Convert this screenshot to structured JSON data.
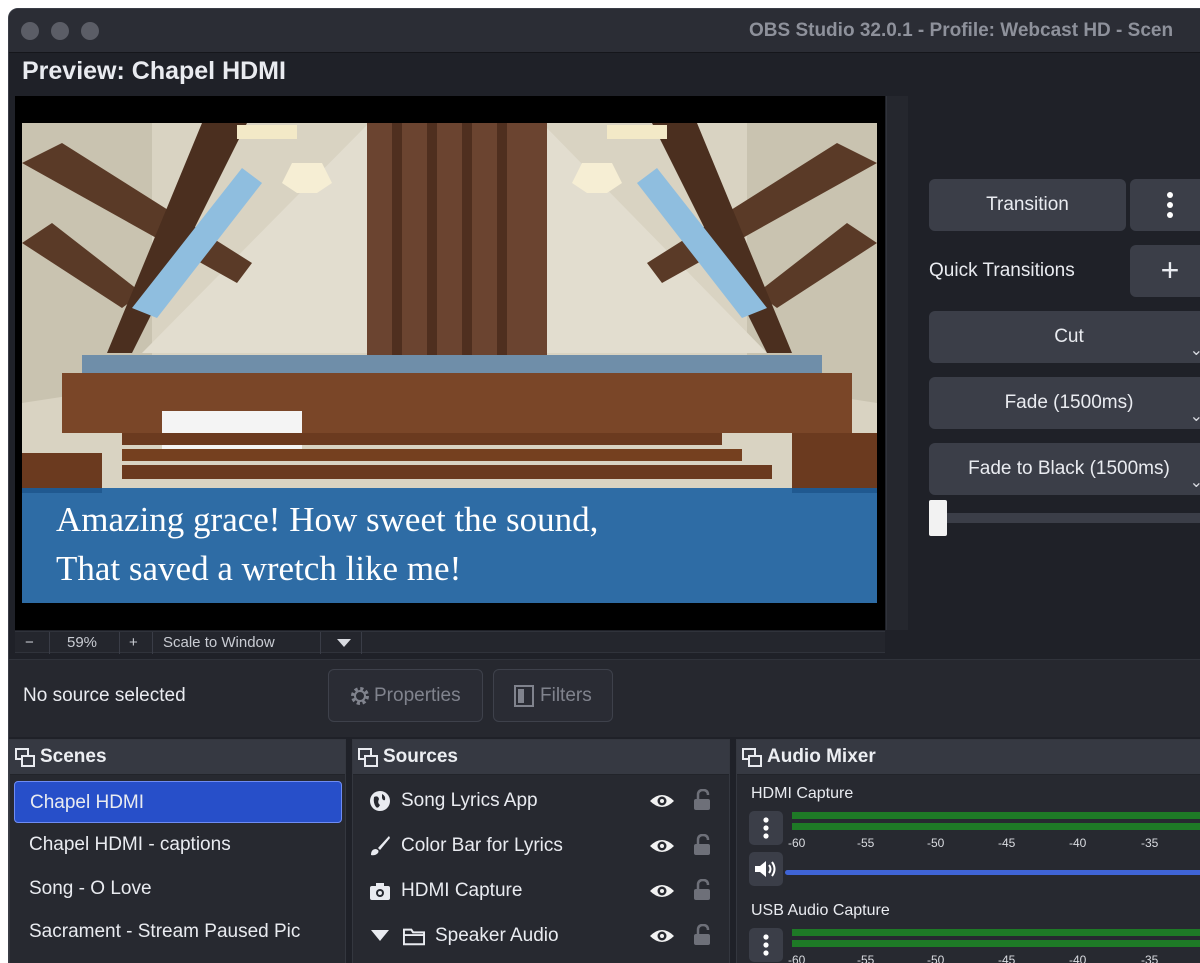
{
  "window": {
    "title": "OBS Studio 32.0.1 - Profile: Webcast HD - Scen"
  },
  "preview": {
    "title": "Preview: Chapel HDMI",
    "lyrics": [
      "Amazing grace! How sweet the sound,",
      "That saved a wretch like me!"
    ],
    "zoom": {
      "minus": "−",
      "value": "59%",
      "plus": "+",
      "scale_mode": "Scale to Window"
    }
  },
  "transitions": {
    "transition_button": "Transition",
    "quick_label": "Quick Transitions",
    "add_symbol": "+",
    "items": [
      {
        "label": "Cut"
      },
      {
        "label": "Fade (1500ms)"
      },
      {
        "label": "Fade to Black (1500ms)"
      }
    ],
    "slider_position": 0
  },
  "properties_bar": {
    "status": "No source selected",
    "properties_label": "Properties",
    "filters_label": "Filters"
  },
  "scenes": {
    "title": "Scenes",
    "items": [
      {
        "label": "Chapel HDMI",
        "selected": true
      },
      {
        "label": "Chapel HDMI - captions",
        "selected": false
      },
      {
        "label": "Song - O Love",
        "selected": false
      },
      {
        "label": "Sacrament - Stream Paused Pic",
        "selected": false
      }
    ]
  },
  "sources": {
    "title": "Sources",
    "items": [
      {
        "label": "Song Lyrics App",
        "icon": "globe-icon"
      },
      {
        "label": "Color Bar for Lyrics",
        "icon": "brush-icon"
      },
      {
        "label": "HDMI Capture",
        "icon": "camera-icon"
      },
      {
        "label": "Speaker Audio",
        "icon": "folder-icon"
      }
    ]
  },
  "audio_mixer": {
    "title": "Audio Mixer",
    "ticks": [
      "-60",
      "-55",
      "-50",
      "-45",
      "-40",
      "-35"
    ],
    "channels": [
      {
        "name": "HDMI Capture",
        "volume_level": 1.0
      },
      {
        "name": "USB Audio Capture",
        "volume_level": 1.0
      }
    ]
  },
  "colors": {
    "accent": "#274fc9",
    "meter_green": "#1e7a26",
    "volume_blue": "#3f64d6"
  }
}
